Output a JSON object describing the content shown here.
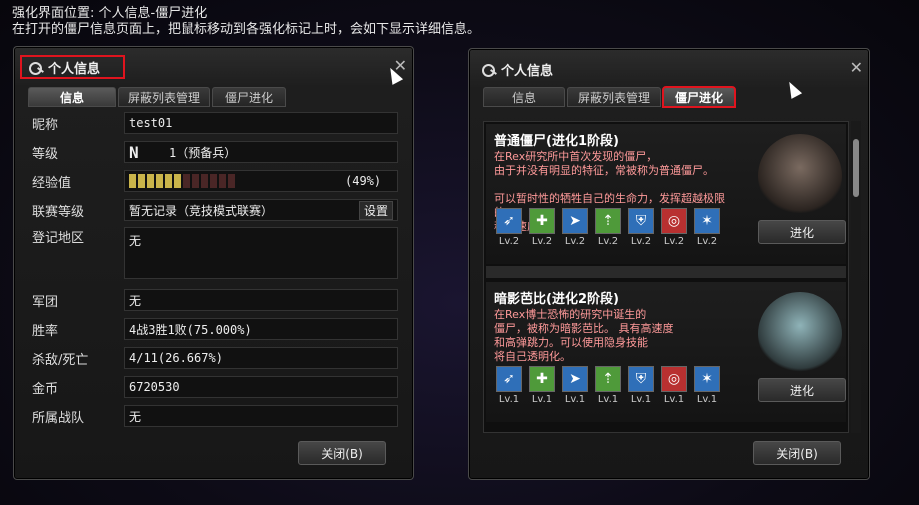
{
  "captions": {
    "line1": "强化界面位置: 个人信息-僵尸进化",
    "line2": "在打开的僵尸信息页面上，把鼠标移动到各强化标记上时，会如下显示详细信息。"
  },
  "left_panel": {
    "title": "个人信息",
    "tabs": [
      "信息",
      "屏蔽列表管理",
      "僵尸进化"
    ],
    "rows": {
      "nickname": {
        "label": "昵称",
        "value": "test01"
      },
      "rank": {
        "label": "等级",
        "letter": "N",
        "value": "1（预备兵）"
      },
      "exp": {
        "label": "经验值",
        "percent": "(49%)",
        "progress": 0.49
      },
      "league": {
        "label": "联赛等级",
        "value": "暂无记录（竞技模式联赛）",
        "button": "设置"
      },
      "region": {
        "label": "登记地区",
        "value": "无"
      },
      "clan": {
        "label": "军团",
        "value": "无"
      },
      "winrate": {
        "label": "胜率",
        "value": "4战3胜1败(75.000%)"
      },
      "kd": {
        "label": "杀敌/死亡",
        "value": "4/11(26.667%)"
      },
      "gold": {
        "label": "金币",
        "value": "6720530"
      },
      "team": {
        "label": "所属战队",
        "value": "无"
      }
    },
    "close_button": "关闭(B)"
  },
  "right_panel": {
    "title": "个人信息",
    "tabs": [
      "信息",
      "屏蔽列表管理",
      "僵尸进化"
    ],
    "zombies": [
      {
        "title": "普通僵尸(进化1阶段)",
        "desc": "在Rex研究所中首次发现的僵尸，\n由于并没有明显的特征，常被称为普通僵尸。\n\n可以暂时性的牺牲自己的生命力，发挥超越极限的\n移动速度。",
        "skills": [
          "Lv.2",
          "Lv.2",
          "Lv.2",
          "Lv.2",
          "Lv.2",
          "Lv.2",
          "Lv.2"
        ],
        "button": "进化"
      },
      {
        "title": "暗影芭比(进化2阶段)",
        "desc": "在Rex博士恐怖的研究中诞生的\n僵尸，被称为暗影芭比。 具有高速度\n和高弹跳力。可以使用隐身技能\n将自己透明化。",
        "skills": [
          "Lv.1",
          "Lv.1",
          "Lv.1",
          "Lv.1",
          "Lv.1",
          "Lv.1",
          "Lv.1"
        ],
        "button": "进化"
      }
    ],
    "skill_icons": [
      "run-icon",
      "heal-icon",
      "sprint-icon",
      "boost-icon",
      "armor-icon",
      "target-icon",
      "star-icon"
    ],
    "skill_colors": [
      "#2f6fb8",
      "#4f9a3a",
      "#2f6fb8",
      "#4f9a3a",
      "#2f6fb8",
      "#b83030",
      "#2f6fb8"
    ],
    "close_button": "关闭(B)"
  }
}
